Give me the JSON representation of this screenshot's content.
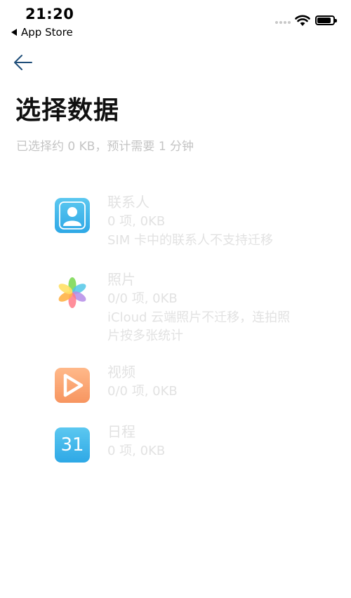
{
  "status_bar": {
    "time": "21:20",
    "back_app": "App Store"
  },
  "header": {
    "title": "选择数据",
    "summary": "已选择约 0 KB，预计需要 1 分钟"
  },
  "items": [
    {
      "name": "联系人",
      "count": "0 项, 0KB",
      "note": "SIM 卡中的联系人不支持迁移",
      "icon": "contacts-icon"
    },
    {
      "name": "照片",
      "count": "0/0 项, 0KB",
      "note": "iCloud 云端照片不迁移，连拍照片按多张统计",
      "icon": "photos-icon"
    },
    {
      "name": "视频",
      "count": "0/0 项, 0KB",
      "note": "",
      "icon": "video-icon"
    },
    {
      "name": "日程",
      "count": "0 项, 0KB",
      "note": "",
      "icon": "calendar-icon",
      "icon_text": "31"
    }
  ],
  "colors": {
    "disabled_text": "#e2e2e2",
    "summary_text": "#c4c4c4",
    "accent": "#1f4e79"
  }
}
